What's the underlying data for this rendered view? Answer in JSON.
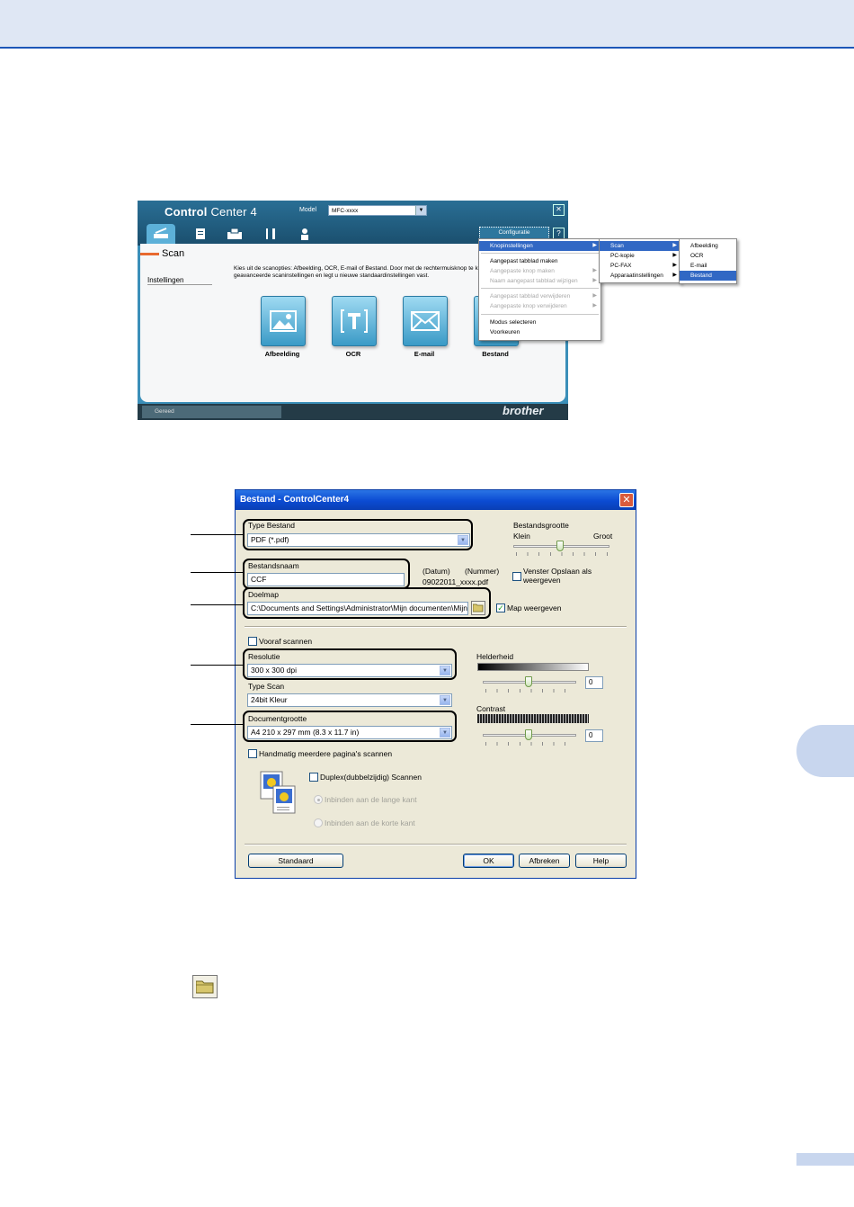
{
  "colors": {
    "header_band": "#dfe7f4",
    "header_rule": "#1d56b8",
    "side_tab": "#c8d6ee",
    "cc4_blue": "#3b8fb9",
    "xp_title": "#0b4bd2"
  },
  "cc4": {
    "logo_bold": "Control",
    "logo_light": "Center 4",
    "model_label": "Model",
    "model_value": "MFC-xxxx",
    "configure_button": "Configuratie",
    "help_button": "?",
    "close_button": "✕",
    "tabs": [
      {
        "icon": "scan-icon"
      },
      {
        "icon": "pc-copy-icon"
      },
      {
        "icon": "pc-fax-icon"
      },
      {
        "icon": "device-settings-icon"
      },
      {
        "icon": "support-icon"
      }
    ],
    "section_title": "Scan",
    "settings_label": "Instellingen",
    "description": "Kies uit de scanopties: Afbeelding, OCR, E-mail of Bestand. Door met de rechtermuisknop te klikken configureert u de geavanceerde scaninstellingen en legt u nieuwe standaardinstellingen vast.",
    "buttons": [
      {
        "label": "Afbeelding",
        "icon": "image-icon"
      },
      {
        "label": "OCR",
        "icon": "ocr-icon"
      },
      {
        "label": "E-mail",
        "icon": "envelope-icon"
      },
      {
        "label": "Bestand",
        "icon": "file-icon"
      }
    ],
    "status": "Gereed",
    "brand": "brother"
  },
  "menus": {
    "main": [
      "Knopinstellingen",
      "Aangepast tabblad maken",
      "Aangepaste knop maken",
      "Naam aangepast tabblad wijzigen",
      "Aangepast tabblad verwijderen",
      "Aangepaste knop verwijderen",
      "Modus selecteren",
      "Voorkeuren"
    ],
    "sub1": [
      "Scan",
      "PC-kopie",
      "PC-FAX",
      "Apparaatinstellingen"
    ],
    "sub2": [
      "Afbeelding",
      "OCR",
      "E-mail",
      "Bestand"
    ]
  },
  "dialog": {
    "title": "Bestand - ControlCenter4",
    "close": "✕",
    "file_type_label": "Type Bestand",
    "file_type_value": "PDF (*.pdf)",
    "file_size_label": "Bestandsgrootte",
    "file_size_small": "Klein",
    "file_size_large": "Groot",
    "file_name_label": "Bestandsnaam",
    "file_name_value": "CCF",
    "date_label": "(Datum)",
    "number_label": "(Nummer)",
    "file_name_preview": "09022011_xxxx.pdf",
    "save_as_checkbox": "Venster Opslaan als weergeven",
    "folder_label": "Doelmap",
    "folder_value": "C:\\Documents and Settings\\Administrator\\Mijn documenten\\Mijn",
    "show_folder_checkbox": "Map weergeven",
    "prescan_checkbox": "Vooraf scannen",
    "resolution_label": "Resolutie",
    "resolution_value": "300 x 300 dpi",
    "brightness_label": "Helderheid",
    "brightness_value": "0",
    "scan_type_label": "Type Scan",
    "scan_type_value": "24bit Kleur",
    "contrast_label": "Contrast",
    "contrast_value": "0",
    "doc_size_label": "Documentgrootte",
    "doc_size_value": "A4 210 x 297 mm (8.3 x 11.7 in)",
    "manual_multi_checkbox": "Handmatig meerdere pagina's scannen",
    "duplex_checkbox": "Duplex(dubbelzijdig) Scannen",
    "long_edge_radio": "Inbinden aan de lange kant",
    "short_edge_radio": "Inbinden aan de korte kant",
    "default_button": "Standaard",
    "ok_button": "OK",
    "cancel_button": "Afbreken",
    "help_button": "Help"
  }
}
